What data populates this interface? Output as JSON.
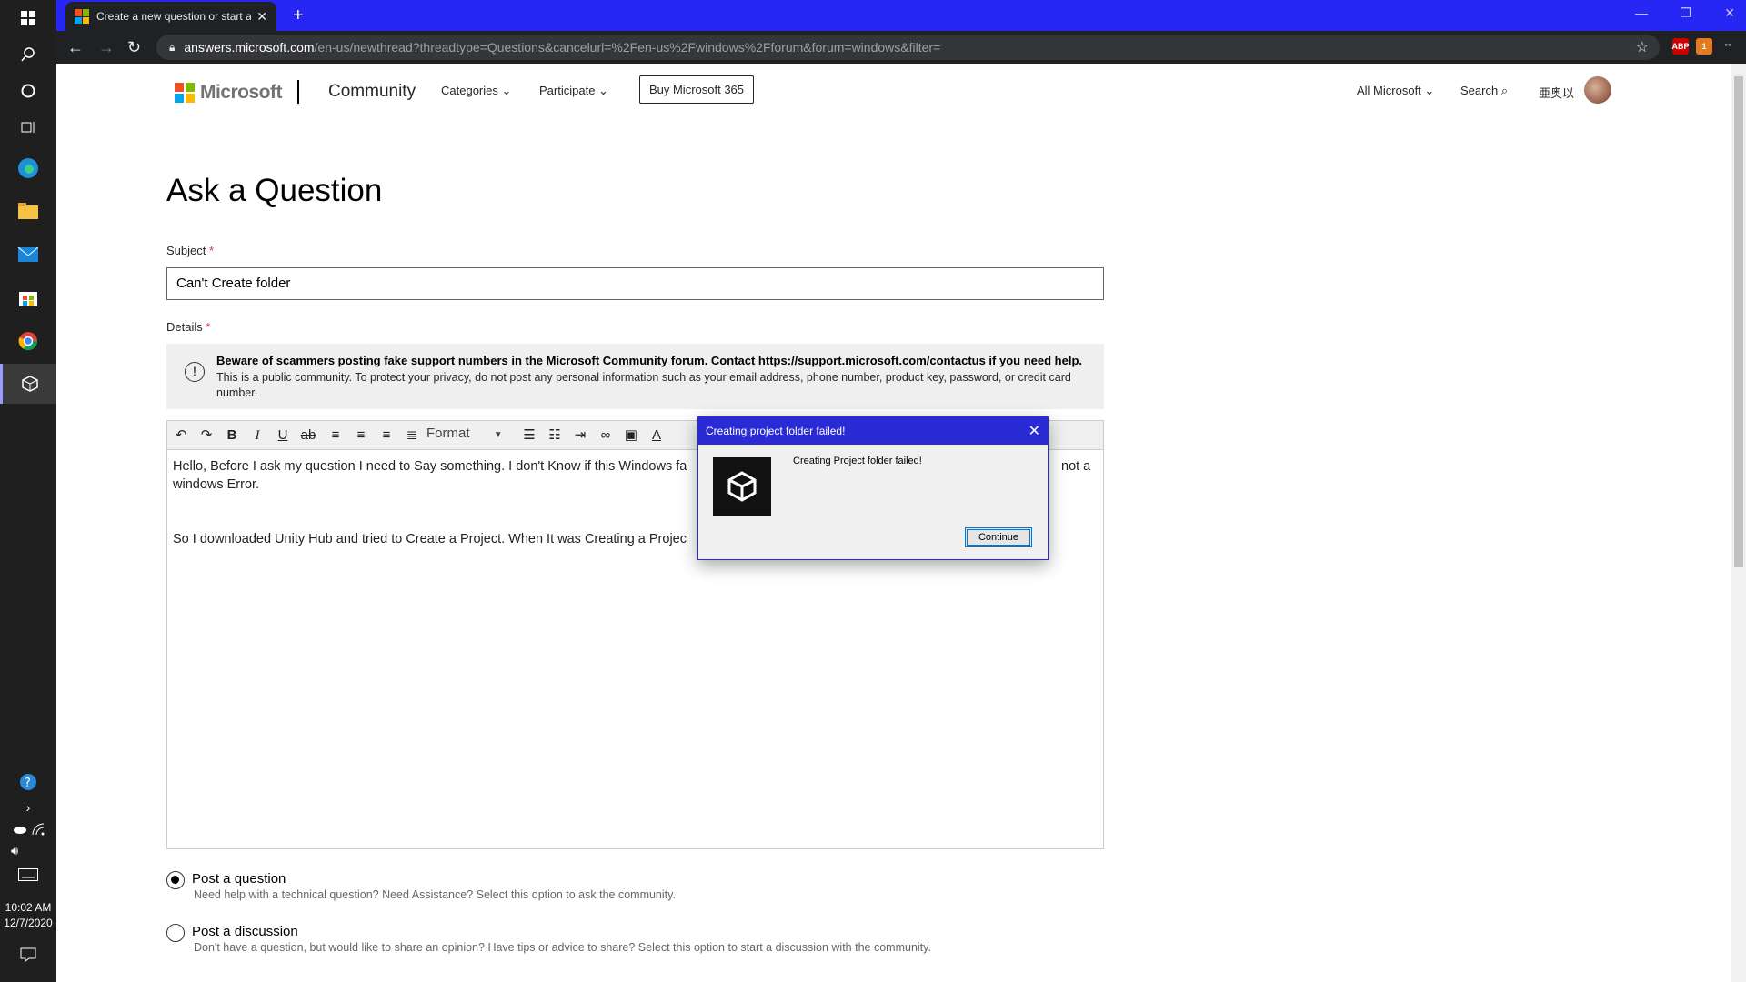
{
  "taskbar": {
    "time": "10:02 AM",
    "date": "12/7/2020",
    "items": [
      "windows-logo",
      "search",
      "cortana",
      "task-view",
      "edge",
      "file-explorer",
      "mail",
      "store",
      "chrome",
      "unity"
    ]
  },
  "browser": {
    "tab_title": "Create a new question or start a",
    "url_host": "answers.microsoft.com",
    "url_path": "/en-us/newthread?threadtype=Questions&cancelurl=%2Fen-us%2Fwindows%2Fforum&forum=windows&filter=",
    "accent_color": "#2727f5"
  },
  "header": {
    "brand": "Microsoft",
    "community": "Community",
    "categories": "Categories",
    "participate": "Participate",
    "buy": "Buy Microsoft 365",
    "all_microsoft": "All Microsoft",
    "search": "Search",
    "username": "亜奥以"
  },
  "form": {
    "heading": "Ask a Question",
    "subject_label": "Subject",
    "subject_value": "Can't Create folder",
    "details_label": "Details",
    "notice_bold": "Beware of scammers posting fake support numbers in the Microsoft Community forum. Contact https://support.microsoft.com/contactus if you need help.",
    "notice_body": "This is a public community. To protect your privacy, do not post any personal information such as your email address, phone number, product key, password, or credit card number.",
    "format_label": "Format",
    "body_line1": "Hello, Before I ask my question I need to Say something. I don't Know if this Windows fa",
    "body_line1_tail": "not a",
    "body_line2": "windows Error.",
    "body_line3": "So I downloaded Unity Hub and tried to Create a Project. When It was Creating a Projec",
    "option1_label": "Post a question",
    "option1_desc": "Need help with a technical question? Need Assistance? Select this option to ask the community.",
    "option2_label": "Post a discussion",
    "option2_desc": "Don't have a question, but would like to share an opinion? Have tips or advice to share? Select this option to start a discussion with the community."
  },
  "dialog": {
    "title": "Creating project folder failed!",
    "message": "Creating Project folder failed!",
    "button": "Continue"
  }
}
